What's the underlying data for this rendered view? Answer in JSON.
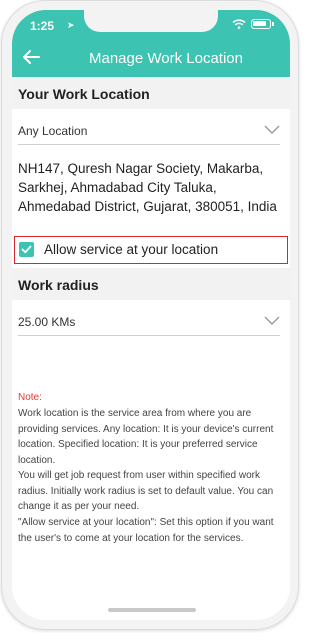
{
  "status_bar": {
    "time": "1:25"
  },
  "header": {
    "title": "Manage Work Location"
  },
  "work_location": {
    "section_title": "Your Work Location",
    "dropdown_value": "Any Location",
    "address": "NH147, Quresh Nagar Society, Makarba, Sarkhej, Ahmadabad City Taluka, Ahmedabad District, Gujarat, 380051, India",
    "allow_checkbox": {
      "checked": true,
      "label": "Allow service at your location"
    }
  },
  "work_radius": {
    "section_title": "Work radius",
    "dropdown_value": "25.00 KMs"
  },
  "note": {
    "title": "Note:",
    "paragraphs": [
      "Work location is the service area from where you are providing services. Any location: It is your device's current location. Specified location: It is your preferred service location.",
      "You will get job request from user within specified work radius. Initially work radius is set to default value. You can change it as per your need.",
      "\"Allow service at your location\": Set this option if you want the user's to come at your location for the services."
    ]
  },
  "colors": {
    "accent": "#3cc3b1",
    "highlight_border": "#d9262c",
    "note_title": "#e23a2e"
  }
}
